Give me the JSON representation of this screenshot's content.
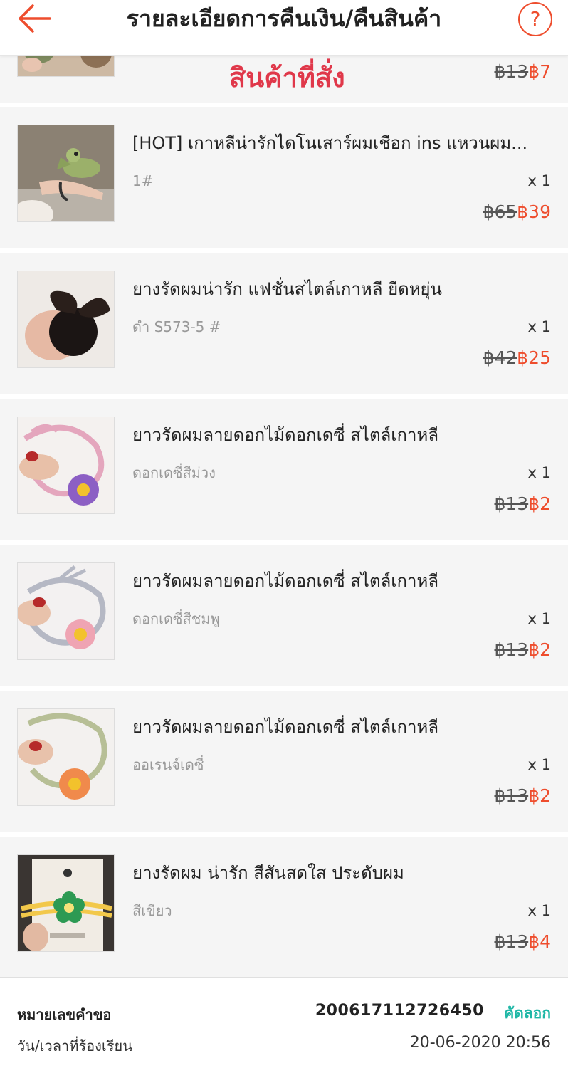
{
  "header": {
    "title": "รายละเอียดการคืนเงิน/คืนสินค้า",
    "help_symbol": "?"
  },
  "section_label": "สินค้าที่สั่ง",
  "partial_item": {
    "old_price": "฿13",
    "new_price": "฿7"
  },
  "items": [
    {
      "name": "[HOT] เกาหลีน่ารักไดโนเสาร์ผมเชือก ins แหวนผม...",
      "variant": "1#",
      "qty": "x 1",
      "old_price": "฿65",
      "new_price": "฿39"
    },
    {
      "name": "ยางรัดผมน่ารัก แฟชั่นสไตล์เกาหลี ยืดหยุ่น",
      "variant": "ดำ S573-5 #",
      "qty": "x 1",
      "old_price": "฿42",
      "new_price": "฿25"
    },
    {
      "name": "ยาวรัดผมลายดอกไม้ดอกเดซี่ สไตล์เกาหลี",
      "variant": "ดอกเดซี่สีม่วง",
      "qty": "x 1",
      "old_price": "฿13",
      "new_price": "฿2"
    },
    {
      "name": "ยาวรัดผมลายดอกไม้ดอกเดซี่ สไตล์เกาหลี",
      "variant": "ดอกเดซี่สีชมพู",
      "qty": "x 1",
      "old_price": "฿13",
      "new_price": "฿2"
    },
    {
      "name": "ยาวรัดผมลายดอกไม้ดอกเดซี่ สไตล์เกาหลี",
      "variant": "ออเรนจ์เดซี่",
      "qty": "x 1",
      "old_price": "฿13",
      "new_price": "฿2"
    },
    {
      "name": "ยางรัดผม น่ารัก สีสันสดใส ประดับผม",
      "variant": "สีเขียว",
      "qty": "x 1",
      "old_price": "฿13",
      "new_price": "฿4"
    }
  ],
  "footer": {
    "request_number_label": "หมายเลขคำขอ",
    "request_number": "200617112726450",
    "copy_label": "คัดลอก",
    "datetime_label": "วัน/เวลาที่ร้องเรียน",
    "datetime": "20-06-2020 20:56"
  },
  "colors": {
    "accent": "#ee4d2d",
    "copy": "#1fb7a6",
    "section_label": "#e0384a"
  }
}
